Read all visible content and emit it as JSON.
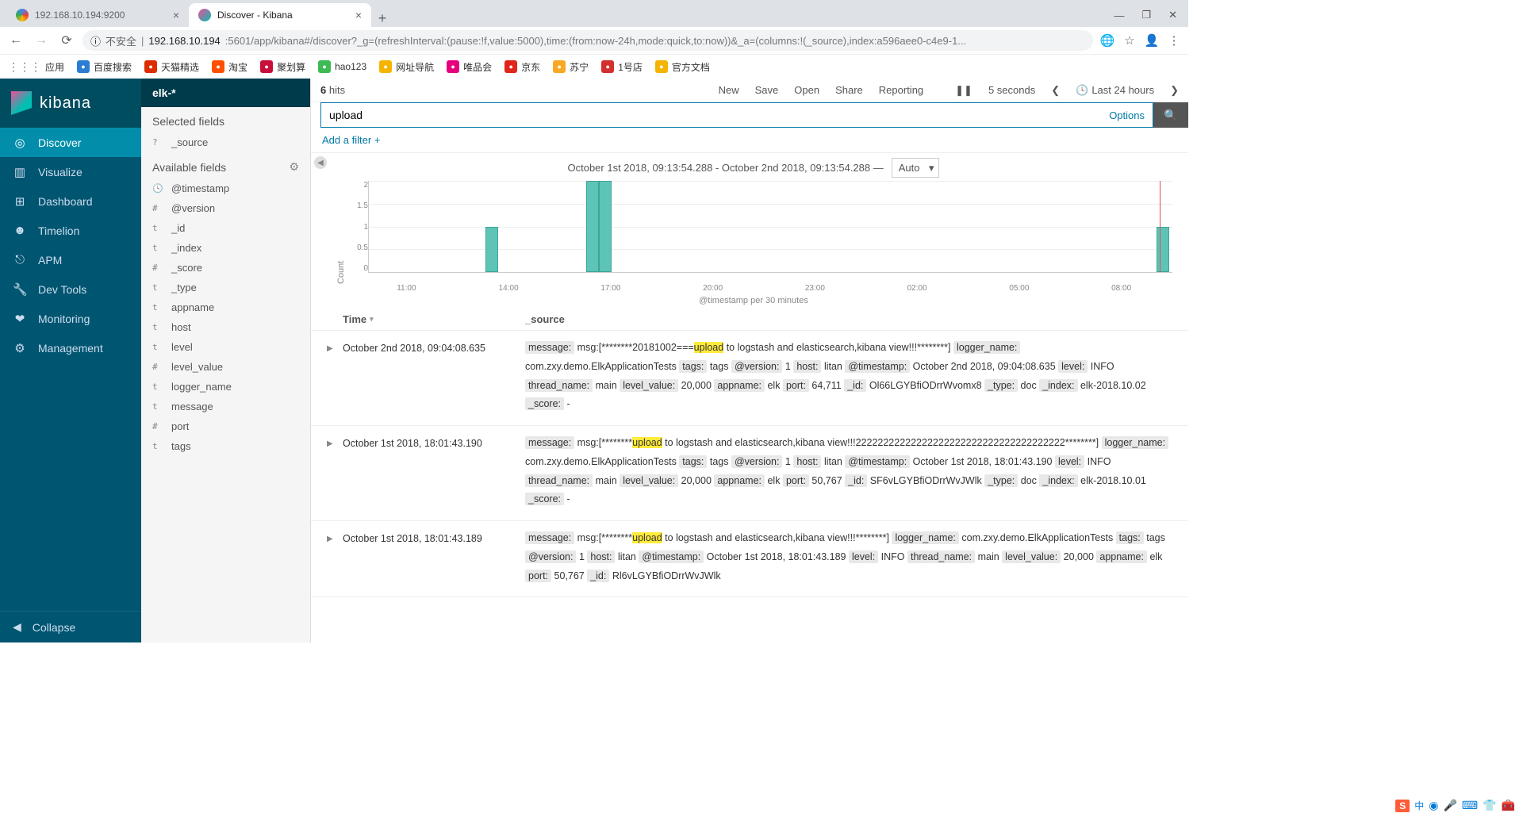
{
  "browser": {
    "tabs": [
      {
        "title": "192.168.10.194:9200",
        "active": false
      },
      {
        "title": "Discover - Kibana",
        "active": true
      }
    ],
    "url_insecure": "不安全",
    "url_host": "192.168.10.194",
    "url_path": ":5601/app/kibana#/discover?_g=(refreshInterval:(pause:!f,value:5000),time:(from:now-24h,mode:quick,to:now))&_a=(columns:!(_source),index:a596aee0-c4e9-1...",
    "bookmarks": [
      {
        "label": "应用",
        "color": "#4285f4"
      },
      {
        "label": "百度搜索",
        "color": "#2b7cd3"
      },
      {
        "label": "天猫精选",
        "color": "#dd2c00"
      },
      {
        "label": "淘宝",
        "color": "#ff5000"
      },
      {
        "label": "聚划算",
        "color": "#c80e3a"
      },
      {
        "label": "hao123",
        "color": "#3cba54"
      },
      {
        "label": "网址导航",
        "color": "#f4b400"
      },
      {
        "label": "唯品会",
        "color": "#e6007e"
      },
      {
        "label": "京东",
        "color": "#e1251b"
      },
      {
        "label": "苏宁",
        "color": "#f9a825"
      },
      {
        "label": "1号店",
        "color": "#d32f2f"
      },
      {
        "label": "官方文档",
        "color": "#f4b400"
      }
    ]
  },
  "kibana": {
    "brand": "kibana",
    "nav": [
      {
        "icon": "◎",
        "label": "Discover",
        "active": true
      },
      {
        "icon": "▥",
        "label": "Visualize"
      },
      {
        "icon": "⊞",
        "label": "Dashboard"
      },
      {
        "icon": "☻",
        "label": "Timelion"
      },
      {
        "icon": "⎋",
        "label": "APM"
      },
      {
        "icon": "🔧",
        "label": "Dev Tools"
      },
      {
        "icon": "❤",
        "label": "Monitoring"
      },
      {
        "icon": "⚙",
        "label": "Management"
      }
    ],
    "collapse": "Collapse"
  },
  "side": {
    "index_pattern": "elk-*",
    "selected_title": "Selected fields",
    "selected": [
      {
        "t": "?",
        "name": "_source"
      }
    ],
    "available_title": "Available fields",
    "available": [
      {
        "t": "🕓",
        "name": "@timestamp"
      },
      {
        "t": "#",
        "name": "@version"
      },
      {
        "t": "t",
        "name": "_id"
      },
      {
        "t": "t",
        "name": "_index"
      },
      {
        "t": "#",
        "name": "_score"
      },
      {
        "t": "t",
        "name": "_type"
      },
      {
        "t": "t",
        "name": "appname"
      },
      {
        "t": "t",
        "name": "host"
      },
      {
        "t": "t",
        "name": "level"
      },
      {
        "t": "#",
        "name": "level_value"
      },
      {
        "t": "t",
        "name": "logger_name"
      },
      {
        "t": "t",
        "name": "message"
      },
      {
        "t": "#",
        "name": "port"
      },
      {
        "t": "t",
        "name": "tags"
      }
    ]
  },
  "topbar": {
    "hits_n": "6",
    "hits_label": "hits",
    "actions": [
      "New",
      "Save",
      "Open",
      "Share",
      "Reporting"
    ],
    "pause": "❚❚",
    "interval": "5 seconds",
    "time_label": "Last 24 hours"
  },
  "search": {
    "value": "upload",
    "options": "Options"
  },
  "filterrow": "Add a filter +",
  "chart_data": {
    "type": "bar",
    "title_range": "October 1st 2018, 09:13:54.288 - October 2nd 2018, 09:13:54.288 —",
    "interval": "Auto",
    "ylabel": "Count",
    "ylim": [
      0,
      2
    ],
    "yticks": [
      "2",
      "1.5",
      "1",
      "0.5",
      "0"
    ],
    "xticks": [
      "11:00",
      "14:00",
      "17:00",
      "20:00",
      "23:00",
      "02:00",
      "05:00",
      "08:00"
    ],
    "xlabel": "@timestamp per 30 minutes",
    "bars": [
      {
        "left_pct": 14.5,
        "height_pct": 50
      },
      {
        "left_pct": 27.0,
        "height_pct": 100
      },
      {
        "left_pct": 28.6,
        "height_pct": 100
      },
      {
        "left_pct": 98.0,
        "height_pct": 50
      }
    ],
    "redline_pct": 98.4
  },
  "table": {
    "col_time": "Time",
    "col_src": "_source",
    "docs": [
      {
        "time": "October 2nd 2018, 09:04:08.635",
        "fields": [
          [
            "message:",
            "msg:[********20181002===",
            "HL:upload",
            " to logstash and elasticsearch,kibana view!!!********]"
          ],
          [
            "logger_name:",
            "com.zxy.demo.ElkApplicationTests"
          ],
          [
            "tags:",
            "tags"
          ],
          [
            "@version:",
            "1"
          ],
          [
            "host:",
            "litan"
          ],
          [
            "@timestamp:",
            "October 2nd 2018, 09:04:08.635"
          ],
          [
            "level:",
            "INFO"
          ],
          [
            "thread_name:",
            "main"
          ],
          [
            "level_value:",
            "20,000"
          ],
          [
            "appname:",
            "elk"
          ],
          [
            "port:",
            "64,711"
          ],
          [
            "_id:",
            "Ol66LGYBfiODrrWvomx8"
          ],
          [
            "_type:",
            "doc"
          ],
          [
            "_index:",
            "elk-2018.10.02"
          ],
          [
            "_score:",
            " - "
          ]
        ]
      },
      {
        "time": "October 1st 2018, 18:01:43.190",
        "fields": [
          [
            "message:",
            "msg:[********",
            "HL:upload",
            " to logstash and elasticsearch,kibana view!!!22222222222222222222222222222222222222********]"
          ],
          [
            "logger_name:",
            "com.zxy.demo.ElkApplicationTests"
          ],
          [
            "tags:",
            "tags"
          ],
          [
            "@version:",
            "1"
          ],
          [
            "host:",
            "litan"
          ],
          [
            "@timestamp:",
            "October 1st 2018, 18:01:43.190"
          ],
          [
            "level:",
            "INFO"
          ],
          [
            "thread_name:",
            "main"
          ],
          [
            "level_value:",
            "20,000"
          ],
          [
            "appname:",
            "elk"
          ],
          [
            "port:",
            "50,767"
          ],
          [
            "_id:",
            "SF6vLGYBfiODrrWvJWlk"
          ],
          [
            "_type:",
            "doc"
          ],
          [
            "_index:",
            "elk-2018.10.01"
          ],
          [
            "_score:",
            " - "
          ]
        ]
      },
      {
        "time": "October 1st 2018, 18:01:43.189",
        "fields": [
          [
            "message:",
            "msg:[********",
            "HL:upload",
            " to logstash and elasticsearch,kibana view!!!********]"
          ],
          [
            "logger_name:",
            "com.zxy.demo.ElkApplicationTests"
          ],
          [
            "tags:",
            "tags"
          ],
          [
            "@version:",
            "1"
          ],
          [
            "host:",
            "litan"
          ],
          [
            "@timestamp:",
            "October 1st 2018, 18:01:43.189"
          ],
          [
            "level:",
            "INFO"
          ],
          [
            "thread_name:",
            "main"
          ],
          [
            "level_value:",
            "20,000"
          ],
          [
            "appname:",
            "elk"
          ],
          [
            "port:",
            "50,767"
          ],
          [
            "_id:",
            "Rl6vLGYBfiODrrWvJWlk"
          ]
        ]
      }
    ]
  },
  "ime": {
    "s": "S",
    "cn": "中"
  }
}
